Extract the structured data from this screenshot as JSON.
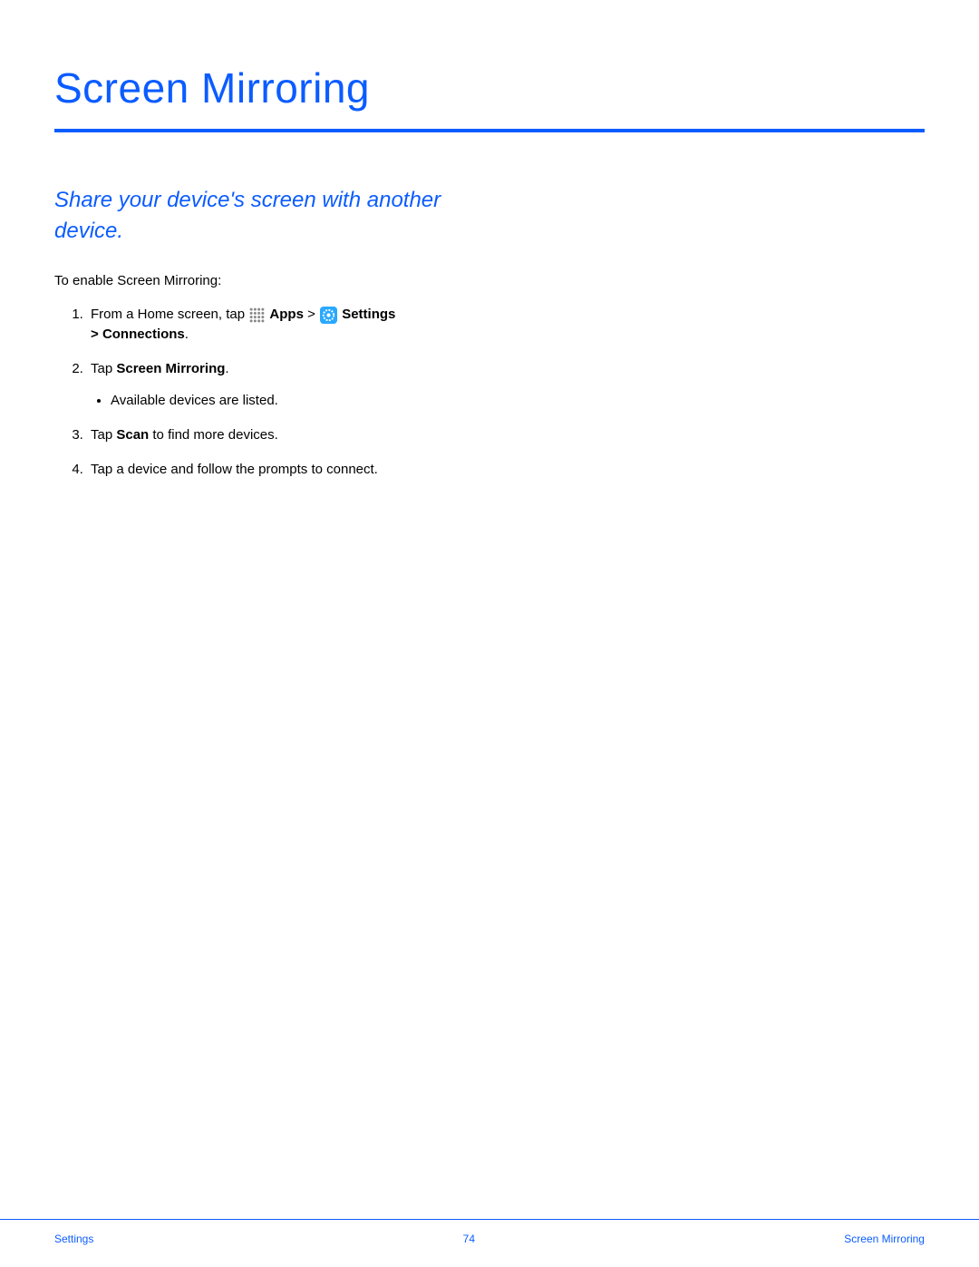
{
  "title": "Screen Mirroring",
  "subtitle": "Share your device's screen with another device.",
  "intro": "To enable Screen Mirroring:",
  "steps": {
    "s1": {
      "pre": "From a Home screen, tap ",
      "apps": "Apps",
      "sep": " > ",
      "settings": "Settings",
      "post": " > ",
      "connections": "Connections",
      "end": "."
    },
    "s2": {
      "pre": "Tap ",
      "bold": "Screen Mirroring",
      "end": ".",
      "bullet": "Available devices are listed."
    },
    "s3": {
      "pre": "Tap ",
      "bold": "Scan",
      "post": " to find more devices."
    },
    "s4": "Tap a device and follow the prompts to connect."
  },
  "footer": {
    "left": "Settings",
    "center": "74",
    "right": "Screen Mirroring"
  }
}
